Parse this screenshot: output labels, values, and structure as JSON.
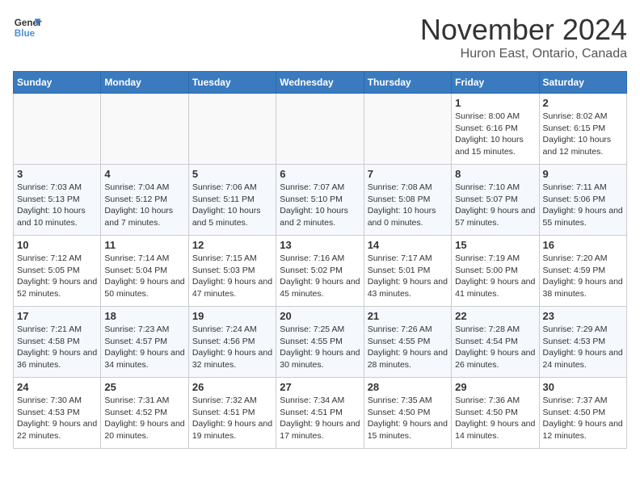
{
  "header": {
    "logo_line1": "General",
    "logo_line2": "Blue",
    "month": "November 2024",
    "location": "Huron East, Ontario, Canada"
  },
  "weekdays": [
    "Sunday",
    "Monday",
    "Tuesday",
    "Wednesday",
    "Thursday",
    "Friday",
    "Saturday"
  ],
  "weeks": [
    [
      {
        "day": "",
        "info": ""
      },
      {
        "day": "",
        "info": ""
      },
      {
        "day": "",
        "info": ""
      },
      {
        "day": "",
        "info": ""
      },
      {
        "day": "",
        "info": ""
      },
      {
        "day": "1",
        "info": "Sunrise: 8:00 AM\nSunset: 6:16 PM\nDaylight: 10 hours and 15 minutes."
      },
      {
        "day": "2",
        "info": "Sunrise: 8:02 AM\nSunset: 6:15 PM\nDaylight: 10 hours and 12 minutes."
      }
    ],
    [
      {
        "day": "3",
        "info": "Sunrise: 7:03 AM\nSunset: 5:13 PM\nDaylight: 10 hours and 10 minutes."
      },
      {
        "day": "4",
        "info": "Sunrise: 7:04 AM\nSunset: 5:12 PM\nDaylight: 10 hours and 7 minutes."
      },
      {
        "day": "5",
        "info": "Sunrise: 7:06 AM\nSunset: 5:11 PM\nDaylight: 10 hours and 5 minutes."
      },
      {
        "day": "6",
        "info": "Sunrise: 7:07 AM\nSunset: 5:10 PM\nDaylight: 10 hours and 2 minutes."
      },
      {
        "day": "7",
        "info": "Sunrise: 7:08 AM\nSunset: 5:08 PM\nDaylight: 10 hours and 0 minutes."
      },
      {
        "day": "8",
        "info": "Sunrise: 7:10 AM\nSunset: 5:07 PM\nDaylight: 9 hours and 57 minutes."
      },
      {
        "day": "9",
        "info": "Sunrise: 7:11 AM\nSunset: 5:06 PM\nDaylight: 9 hours and 55 minutes."
      }
    ],
    [
      {
        "day": "10",
        "info": "Sunrise: 7:12 AM\nSunset: 5:05 PM\nDaylight: 9 hours and 52 minutes."
      },
      {
        "day": "11",
        "info": "Sunrise: 7:14 AM\nSunset: 5:04 PM\nDaylight: 9 hours and 50 minutes."
      },
      {
        "day": "12",
        "info": "Sunrise: 7:15 AM\nSunset: 5:03 PM\nDaylight: 9 hours and 47 minutes."
      },
      {
        "day": "13",
        "info": "Sunrise: 7:16 AM\nSunset: 5:02 PM\nDaylight: 9 hours and 45 minutes."
      },
      {
        "day": "14",
        "info": "Sunrise: 7:17 AM\nSunset: 5:01 PM\nDaylight: 9 hours and 43 minutes."
      },
      {
        "day": "15",
        "info": "Sunrise: 7:19 AM\nSunset: 5:00 PM\nDaylight: 9 hours and 41 minutes."
      },
      {
        "day": "16",
        "info": "Sunrise: 7:20 AM\nSunset: 4:59 PM\nDaylight: 9 hours and 38 minutes."
      }
    ],
    [
      {
        "day": "17",
        "info": "Sunrise: 7:21 AM\nSunset: 4:58 PM\nDaylight: 9 hours and 36 minutes."
      },
      {
        "day": "18",
        "info": "Sunrise: 7:23 AM\nSunset: 4:57 PM\nDaylight: 9 hours and 34 minutes."
      },
      {
        "day": "19",
        "info": "Sunrise: 7:24 AM\nSunset: 4:56 PM\nDaylight: 9 hours and 32 minutes."
      },
      {
        "day": "20",
        "info": "Sunrise: 7:25 AM\nSunset: 4:55 PM\nDaylight: 9 hours and 30 minutes."
      },
      {
        "day": "21",
        "info": "Sunrise: 7:26 AM\nSunset: 4:55 PM\nDaylight: 9 hours and 28 minutes."
      },
      {
        "day": "22",
        "info": "Sunrise: 7:28 AM\nSunset: 4:54 PM\nDaylight: 9 hours and 26 minutes."
      },
      {
        "day": "23",
        "info": "Sunrise: 7:29 AM\nSunset: 4:53 PM\nDaylight: 9 hours and 24 minutes."
      }
    ],
    [
      {
        "day": "24",
        "info": "Sunrise: 7:30 AM\nSunset: 4:53 PM\nDaylight: 9 hours and 22 minutes."
      },
      {
        "day": "25",
        "info": "Sunrise: 7:31 AM\nSunset: 4:52 PM\nDaylight: 9 hours and 20 minutes."
      },
      {
        "day": "26",
        "info": "Sunrise: 7:32 AM\nSunset: 4:51 PM\nDaylight: 9 hours and 19 minutes."
      },
      {
        "day": "27",
        "info": "Sunrise: 7:34 AM\nSunset: 4:51 PM\nDaylight: 9 hours and 17 minutes."
      },
      {
        "day": "28",
        "info": "Sunrise: 7:35 AM\nSunset: 4:50 PM\nDaylight: 9 hours and 15 minutes."
      },
      {
        "day": "29",
        "info": "Sunrise: 7:36 AM\nSunset: 4:50 PM\nDaylight: 9 hours and 14 minutes."
      },
      {
        "day": "30",
        "info": "Sunrise: 7:37 AM\nSunset: 4:50 PM\nDaylight: 9 hours and 12 minutes."
      }
    ]
  ]
}
